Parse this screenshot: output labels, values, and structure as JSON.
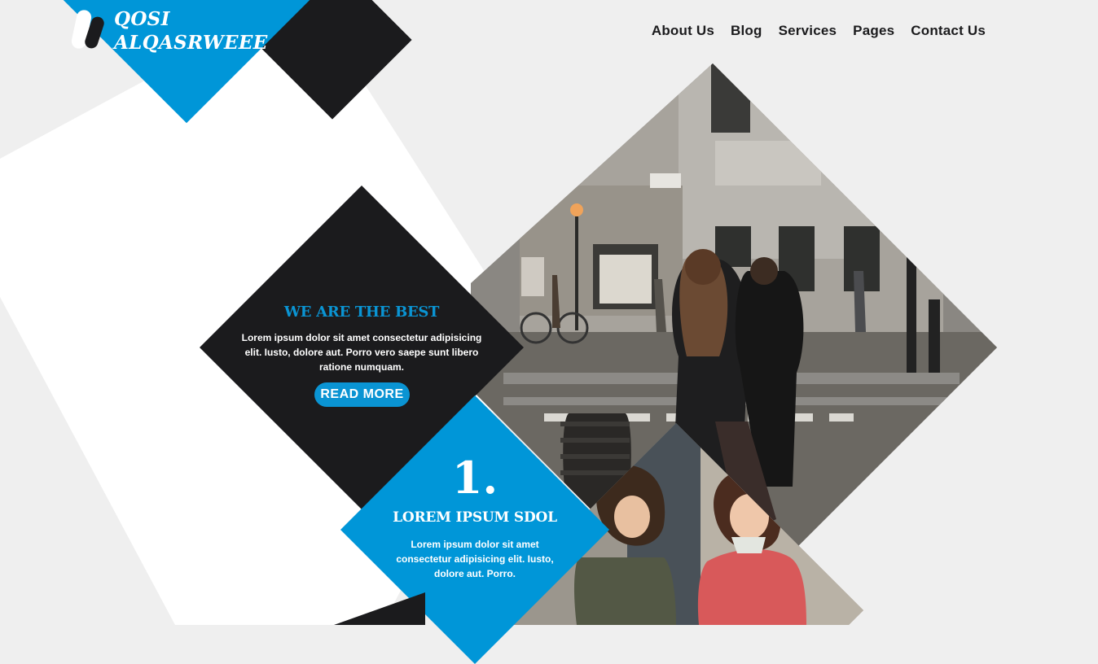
{
  "brand": {
    "name_line1": "QOSI",
    "name_line2": "ALQASRWEEE",
    "icon": "pill-logo-icon",
    "accent_color": "#0096d8",
    "dark_color": "#1b1b1d"
  },
  "nav": {
    "items": [
      {
        "label": "About Us"
      },
      {
        "label": "Blog"
      },
      {
        "label": "Services"
      },
      {
        "label": "Pages"
      },
      {
        "label": "Contact Us"
      }
    ]
  },
  "hero": {
    "headline": "WE ARE THE BEST",
    "body": "Lorem ipsum dolor sit amet consectetur adipisicing elit. Iusto, dolore aut. Porro vero saepe sunt libero ratione numquam.",
    "button_label": "READ MORE"
  },
  "feature": {
    "number": "1.",
    "title": "LOREM IPSUM SDOL",
    "text": "Lorem ipsum dolor sit amet consectetur adipisicing elit. Iusto, dolore aut. Porro."
  },
  "images": {
    "main_photo": "street-crossing-photo",
    "secondary_photo": "children-photo"
  }
}
